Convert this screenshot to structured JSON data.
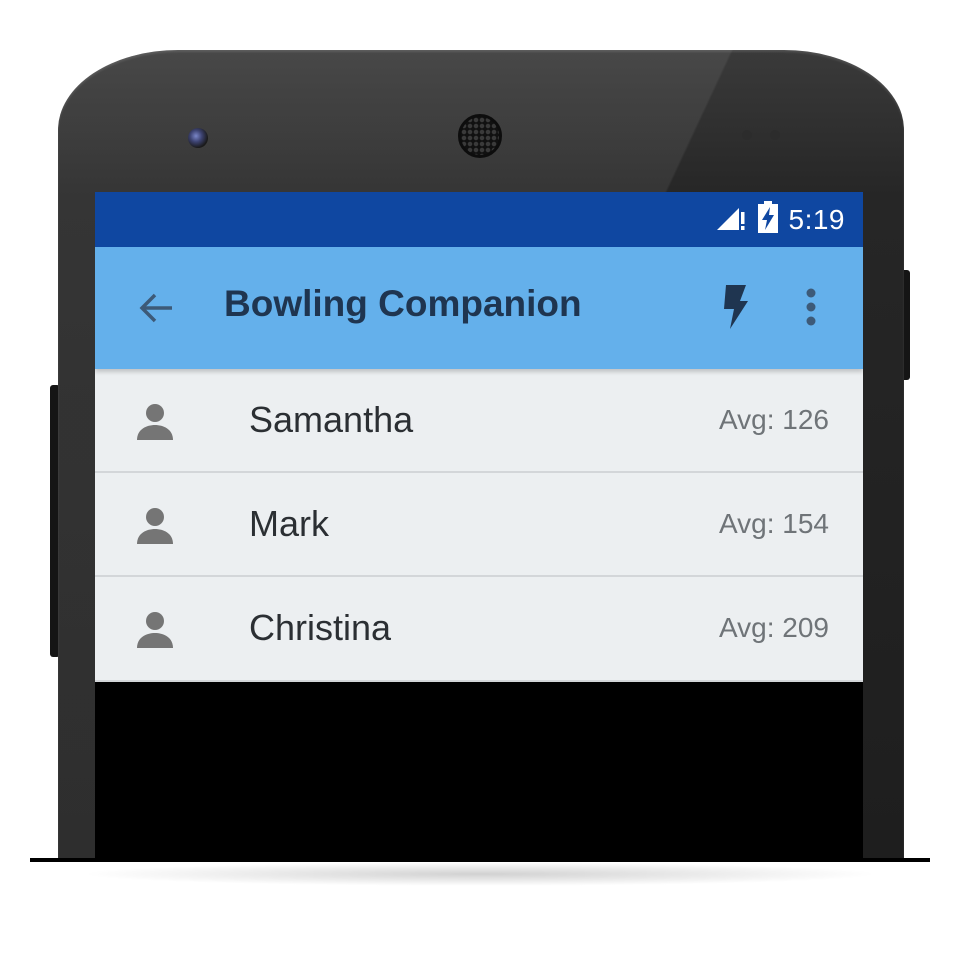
{
  "status_bar": {
    "time": "5:19",
    "icons": [
      "signal-alert-icon",
      "battery-charging-icon"
    ],
    "color": "#0f47a1"
  },
  "app_bar": {
    "title": "Bowling Companion",
    "back_icon": "arrow-back-icon",
    "action_icons": [
      "flash-icon",
      "more-vert-icon"
    ],
    "color": "#64b0eb"
  },
  "players": [
    {
      "name": "Samantha",
      "avg": "Avg: 126",
      "icon": "person-icon"
    },
    {
      "name": "Mark",
      "avg": "Avg: 154",
      "icon": "person-icon"
    },
    {
      "name": "Christina",
      "avg": "Avg: 209",
      "icon": "person-icon"
    }
  ],
  "colors": {
    "list_background": "#eceff1",
    "title_text": "#1f3550",
    "icon_gray": "#757575"
  }
}
